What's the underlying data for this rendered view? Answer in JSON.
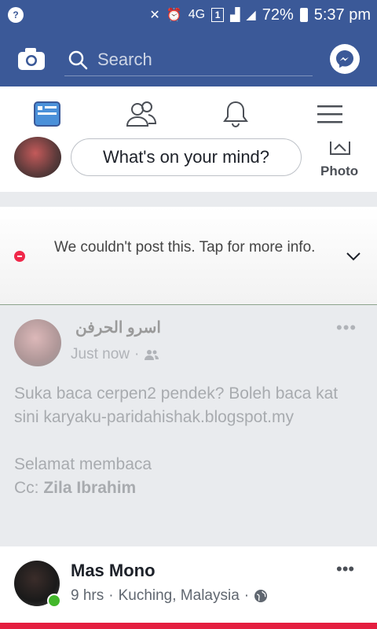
{
  "status_bar": {
    "network": "4G",
    "sim": "1",
    "battery": "72%",
    "time": "5:37 pm"
  },
  "top_bar": {
    "search_placeholder": "Search"
  },
  "composer": {
    "prompt": "What's on your mind?",
    "photo_label": "Photo"
  },
  "error_banner": {
    "message": "We couldn't post this. Tap for more info."
  },
  "failed_post": {
    "author": "اسرو الحرفن",
    "time": "Just now",
    "body_line1": "Suka baca cerpen2 pendek? Boleh baca kat sini karyaku-paridahishak.blogspot.my",
    "body_line2": "Selamat membaca",
    "cc_prefix": "Cc:",
    "cc_name": "Zila Ibrahim"
  },
  "post": {
    "author": "Mas Mono",
    "time": "9 hrs",
    "location": "Kuching, Malaysia"
  },
  "colors": {
    "brand": "#3b5998",
    "error": "#f0284a",
    "online": "#42b72a"
  }
}
